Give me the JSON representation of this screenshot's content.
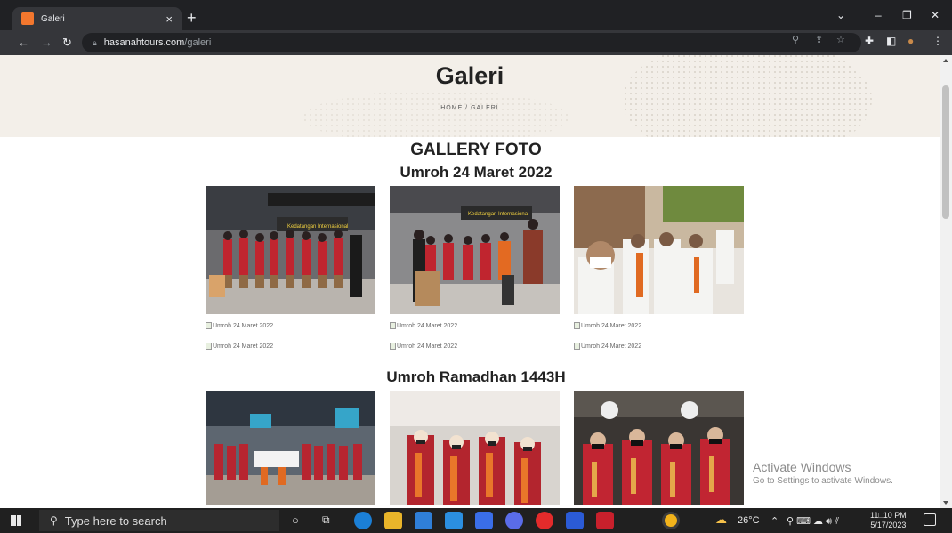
{
  "browser": {
    "tab_title": "Galeri",
    "tab_close": "×",
    "new_tab": "+",
    "url_host": "hasanahtours.com",
    "url_path": "/galeri",
    "window_controls": {
      "minimize": "–",
      "restore": "❐",
      "close": "✕",
      "tab_search": "⌄"
    }
  },
  "banner": {
    "title": "Galeri",
    "breadcrumb": "HOME  /  GALERI"
  },
  "gallery": {
    "heading": "GALLERY FOTO",
    "albums": [
      {
        "title": "Umroh 24 Maret 2022",
        "photos": [
          "airport group 1",
          "airport group 2",
          "madinah pilgrims"
        ],
        "broken_row1": [
          "Umroh 24 Maret 2022",
          "Umroh 24 Maret 2022",
          "Umroh 24 Maret 2022"
        ],
        "broken_row2": [
          "Umroh 24 Maret 2022",
          "Umroh 24 Maret 2022",
          "Umroh 24 Maret 2022"
        ]
      },
      {
        "title": "Umroh Ramadhan 1443H",
        "photos": [
          "terminal group",
          "orange scarves group",
          "night group"
        ]
      }
    ]
  },
  "watermark": {
    "line1": "Activate Windows",
    "line2": "Go to Settings to activate Windows."
  },
  "taskbar": {
    "search_placeholder": "Type here to search",
    "weather": "26°C",
    "time": "11□10 PM",
    "date": "5/17/2023"
  },
  "colors": {
    "banner_bg": "#f3efe9",
    "chrome_dark": "#202124",
    "favicon": "#f3772e"
  }
}
